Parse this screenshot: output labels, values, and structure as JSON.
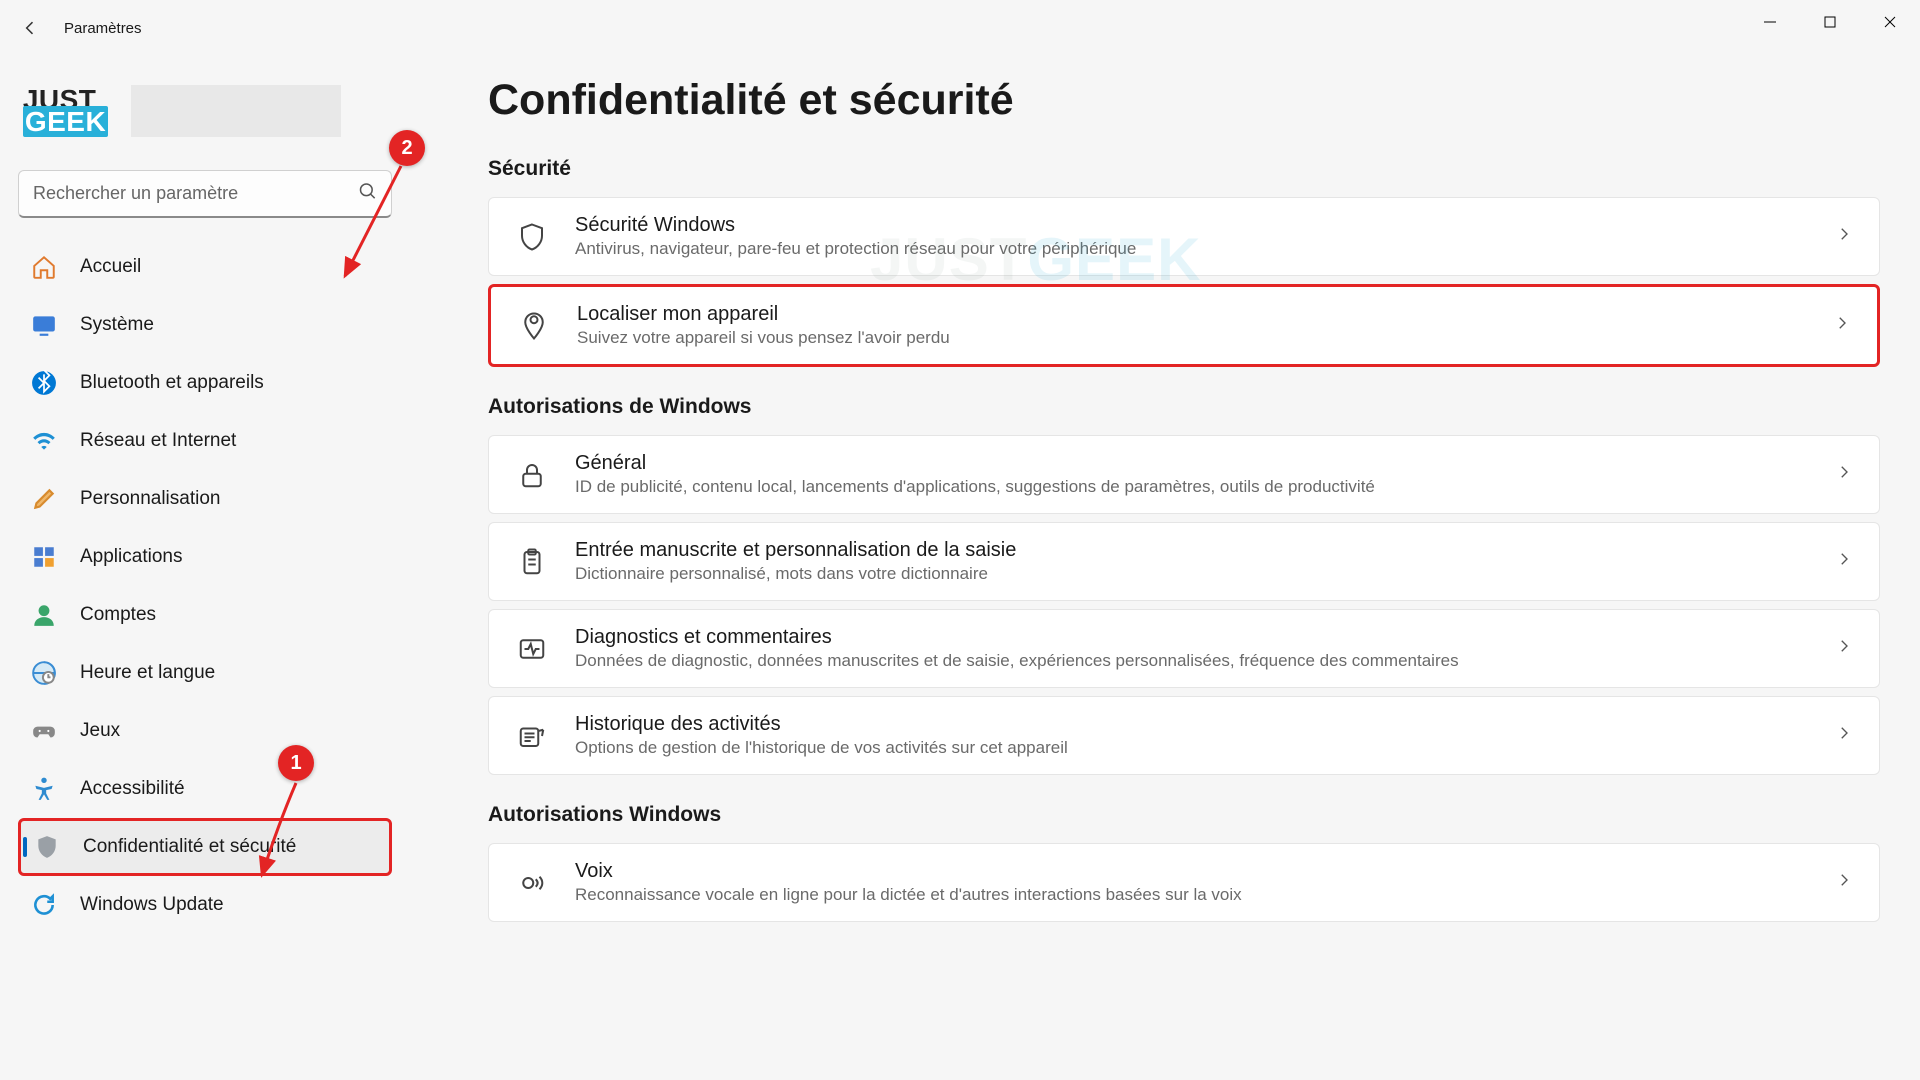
{
  "window": {
    "title": "Paramètres",
    "avatar_line1": "JUST",
    "avatar_line2": "GEEK"
  },
  "search": {
    "placeholder": "Rechercher un paramètre"
  },
  "sidebar": {
    "items": [
      {
        "id": "home",
        "label": "Accueil"
      },
      {
        "id": "system",
        "label": "Système"
      },
      {
        "id": "bluetooth",
        "label": "Bluetooth et appareils"
      },
      {
        "id": "network",
        "label": "Réseau et Internet"
      },
      {
        "id": "personalization",
        "label": "Personnalisation"
      },
      {
        "id": "apps",
        "label": "Applications"
      },
      {
        "id": "accounts",
        "label": "Comptes"
      },
      {
        "id": "time",
        "label": "Heure et langue"
      },
      {
        "id": "gaming",
        "label": "Jeux"
      },
      {
        "id": "accessibility",
        "label": "Accessibilité"
      },
      {
        "id": "privacy",
        "label": "Confidentialité et sécurité"
      },
      {
        "id": "update",
        "label": "Windows Update"
      }
    ],
    "selected_index": 10
  },
  "page": {
    "title": "Confidentialité et sécurité",
    "sections": [
      {
        "header": "Sécurité",
        "items": [
          {
            "id": "windows-security",
            "title": "Sécurité Windows",
            "desc": "Antivirus, navigateur, pare-feu et protection réseau pour votre périphérique"
          },
          {
            "id": "find-my-device",
            "title": "Localiser mon appareil",
            "desc": "Suivez votre appareil si vous pensez l'avoir perdu"
          }
        ]
      },
      {
        "header": "Autorisations de Windows",
        "items": [
          {
            "id": "general",
            "title": "Général",
            "desc": "ID de publicité, contenu local, lancements d'applications, suggestions de paramètres, outils de productivité"
          },
          {
            "id": "inking",
            "title": "Entrée manuscrite et personnalisation de la saisie",
            "desc": "Dictionnaire personnalisé, mots dans votre dictionnaire"
          },
          {
            "id": "diagnostics",
            "title": "Diagnostics et commentaires",
            "desc": "Données de diagnostic, données manuscrites et de saisie, expériences personnalisées, fréquence des commentaires"
          },
          {
            "id": "activity",
            "title": "Historique des activités",
            "desc": "Options de gestion de l'historique de vos activités sur cet appareil"
          }
        ]
      },
      {
        "header": "Autorisations Windows",
        "items": [
          {
            "id": "voice",
            "title": "Voix",
            "desc": "Reconnaissance vocale en ligne pour la dictée et d'autres interactions basées sur la voix"
          }
        ]
      }
    ]
  },
  "annotations": {
    "badge1": "1",
    "badge2": "2"
  },
  "watermark": {
    "a": "JUST",
    "b": "GEEK"
  }
}
